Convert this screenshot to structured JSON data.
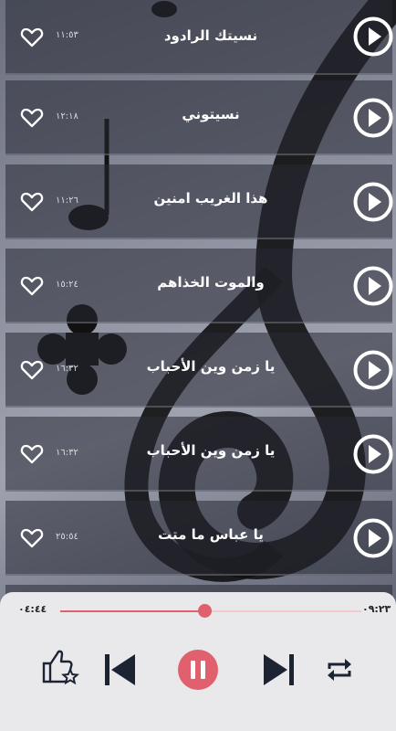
{
  "tracks": [
    {
      "title": "نسيتك  الرادود",
      "duration": "١١:٥٣"
    },
    {
      "title": "نسيتوني",
      "duration": "١٢:١٨"
    },
    {
      "title": "هذا الغريب امنين",
      "duration": "١١:٢٦"
    },
    {
      "title": "والموت الخذاهم",
      "duration": "١٥:٢٤"
    },
    {
      "title": "يا زمن وين الأحباب",
      "duration": "١٦:٣٢"
    },
    {
      "title": "يا زمن وين الأحباب",
      "duration": "١٦:٣٢"
    },
    {
      "title": "يا عباس ما متت",
      "duration": "٢٥:٥٤"
    }
  ],
  "player": {
    "elapsed": "٠٤:٤٤",
    "total": "٠٩:٢٣",
    "progress": 0.48
  },
  "icons": {
    "favorite": "heart-outline-icon",
    "play": "play-circle-icon",
    "rate": "thumbs-up-star-icon",
    "previous": "skip-previous-icon",
    "pause": "pause-icon",
    "next": "skip-next-icon",
    "repeat": "repeat-icon"
  },
  "colors": {
    "accent": "#e0606e",
    "accent_light": "#f3c8cf",
    "player_bg": "#e9e9ec"
  }
}
